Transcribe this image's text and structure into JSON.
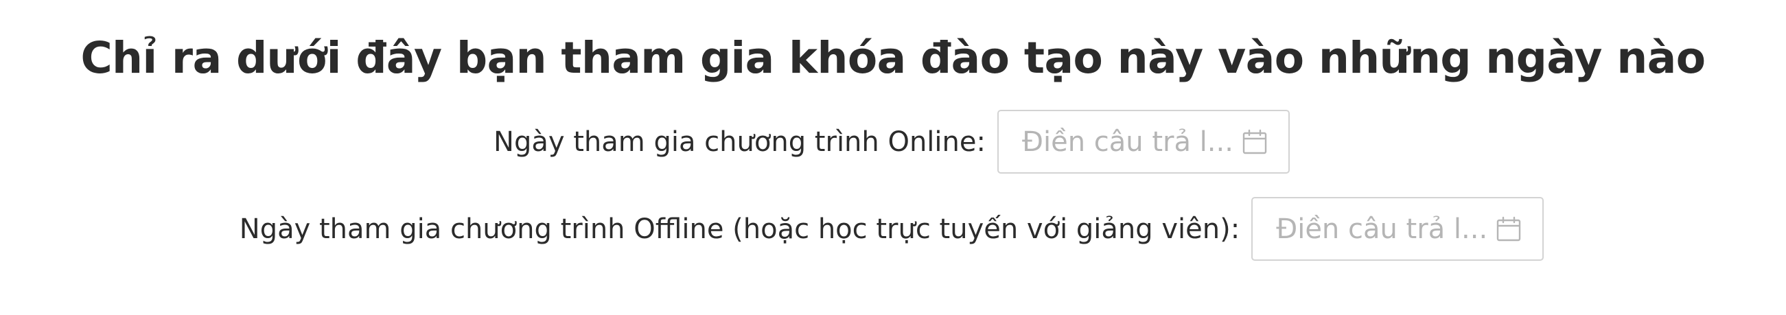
{
  "form": {
    "title": "Chỉ ra dưới đây bạn tham gia khóa đào tạo này vào những ngày nào",
    "fields": [
      {
        "label": "Ngày tham gia chương trình Online:",
        "placeholder": "Điền câu trả l...",
        "icon": "calendar-icon"
      },
      {
        "label": "Ngày tham gia chương trình Offline (hoặc học trực tuyến với giảng viên):",
        "placeholder": "Điền câu trả l...",
        "icon": "calendar-icon"
      }
    ]
  },
  "colors": {
    "text": "#2b2b2b",
    "placeholder": "#b5b5b5",
    "border": "#d3d3d3",
    "icon": "#b5b5b5"
  }
}
